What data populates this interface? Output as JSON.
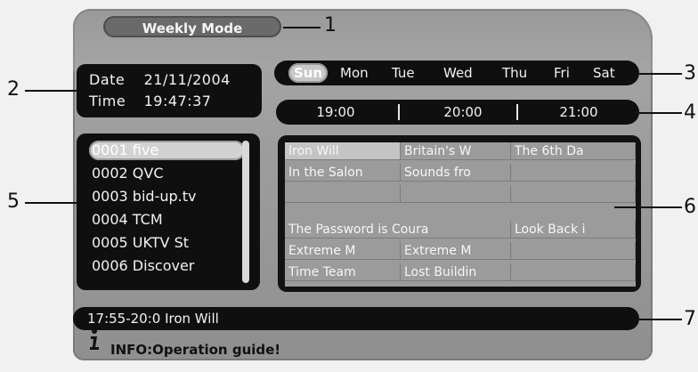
{
  "background": {
    "top_text": "",
    "bottom_text": ""
  },
  "header": {
    "mode_label": "Weekly Mode"
  },
  "datetime": {
    "date_label": "Date",
    "date_value": "21/11/2004",
    "time_label": "Time",
    "time_value": "19:47:37"
  },
  "days": [
    "Sun",
    "Mon",
    "Tue",
    "Wed",
    "Thu",
    "Fri",
    "Sat"
  ],
  "selected_day": "Sun",
  "times": [
    "19:00",
    "20:00",
    "21:00"
  ],
  "channels": [
    "0001 five",
    "0002 QVC",
    "0003 bid-up.tv",
    "0004 TCM",
    "0005 UKTV St",
    "0006 Discover"
  ],
  "epg_rows": [
    [
      "Iron Will",
      "Britain's W",
      "The 6th Da"
    ],
    [
      "In the Salon",
      "Sounds fro",
      ""
    ],
    [
      "",
      "",
      ""
    ],
    [
      "The Password is Coura",
      "",
      "Look Back i"
    ],
    [
      "Extreme M",
      "Extreme M",
      ""
    ],
    [
      "Time Team",
      "Lost Buildin",
      ""
    ]
  ],
  "info_bar": {
    "text": "17:55-20:0  Iron Will"
  },
  "guide": {
    "text": "INFO:Operation guide!"
  },
  "callouts": [
    "1",
    "2",
    "3",
    "4",
    "5",
    "6",
    "7"
  ],
  "colors": {
    "panel": "#9d9d9d",
    "box": "#0f0f0f",
    "text": "#f2f2f2",
    "highlight": "#c8c8c8"
  }
}
